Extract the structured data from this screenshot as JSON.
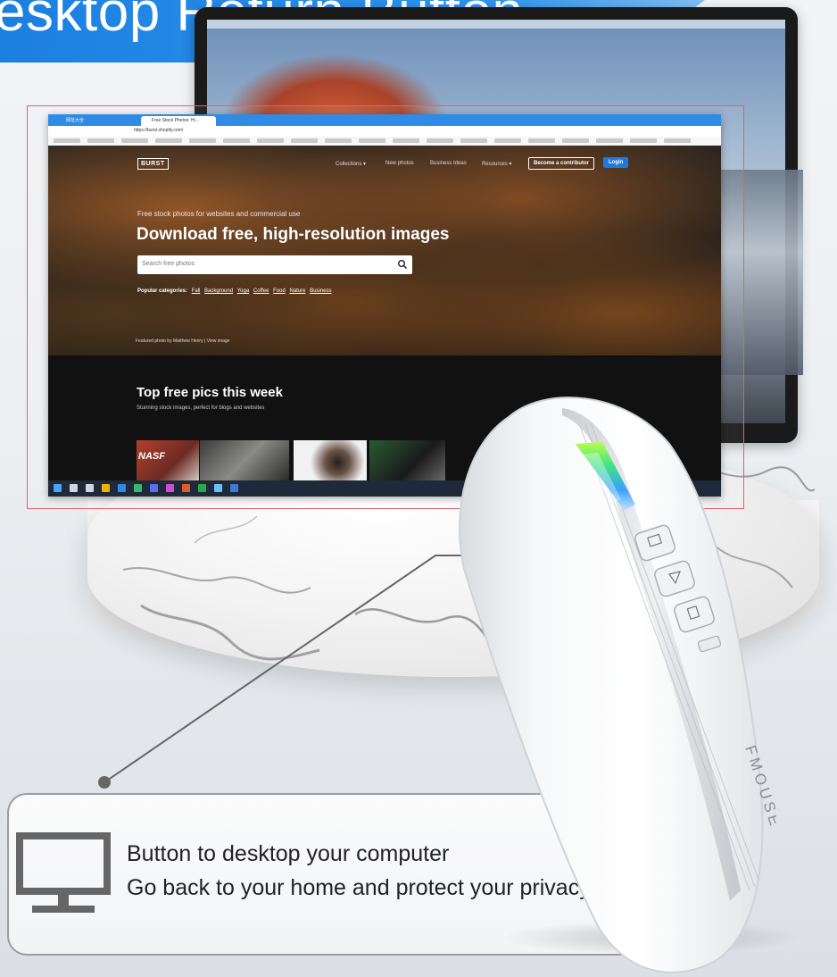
{
  "banner": {
    "title": "esktop Return Button"
  },
  "browser": {
    "tabs": [
      "网址大全",
      "Free Stock Photos: Hi..."
    ],
    "url": "https://burst.shopify.com/"
  },
  "site": {
    "logo": "BURST",
    "nav": [
      "Collections ▾",
      "New photos",
      "Business Ideas",
      "Resources ▾"
    ],
    "contributor_button": "Become a contributor",
    "login_button": "Login",
    "tagline": "Free stock photos for websites and commercial use",
    "hero_title": "Download free, high-resolution images",
    "search_placeholder": "Search free photos",
    "popular_label": "Popular categories:",
    "popular_categories": [
      "Fall",
      "Background",
      "Yoga",
      "Coffee",
      "Food",
      "Nature",
      "Business"
    ],
    "featured_credit": "Featured photo by Matthew Henry | View image",
    "section_title": "Top free pics this week",
    "section_subtitle": "Stunning stock images, perfect for blogs and websites",
    "thumb_text": "NASF"
  },
  "product": {
    "brand": "FMOUSE"
  },
  "callout": {
    "icon": "desktop-monitor-icon",
    "line1": "Button to desktop your computer",
    "line2": "Go back to your home and protect your privacy."
  },
  "colors": {
    "banner": "#2e95ee",
    "frame": "#e5606a",
    "login": "#1d7be0"
  }
}
